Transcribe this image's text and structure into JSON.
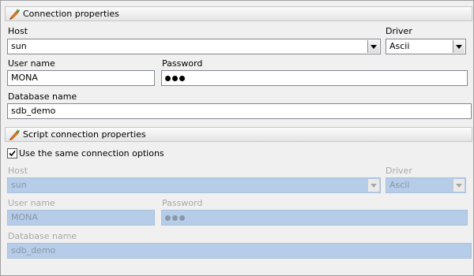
{
  "connection": {
    "header": "Connection properties",
    "host_label": "Host",
    "host_value": "sun",
    "driver_label": "Driver",
    "driver_value": "Ascii",
    "user_label": "User name",
    "user_value": "MONA",
    "password_label": "Password",
    "password_dots": 3,
    "database_label": "Database name",
    "database_value": "sdb_demo"
  },
  "script_connection": {
    "header": "Script connection properties",
    "same_options_label": "Use the same connection options",
    "same_options_checked": true,
    "host_label": "Host",
    "host_value": "sun",
    "driver_label": "Driver",
    "driver_value": "Ascii",
    "user_label": "User name",
    "user_value": "MONA",
    "password_label": "Password",
    "password_dots": 3,
    "database_label": "Database name",
    "database_value": "sdb_demo"
  },
  "icons": {
    "section_icon": "carrot-pencil-icon",
    "dropdown_arrow": "chevron-down-icon",
    "checkmark": "checkmark-icon"
  },
  "colors": {
    "disabled_field_bg": "#b5cde8",
    "disabled_text": "#a8a8a8"
  }
}
